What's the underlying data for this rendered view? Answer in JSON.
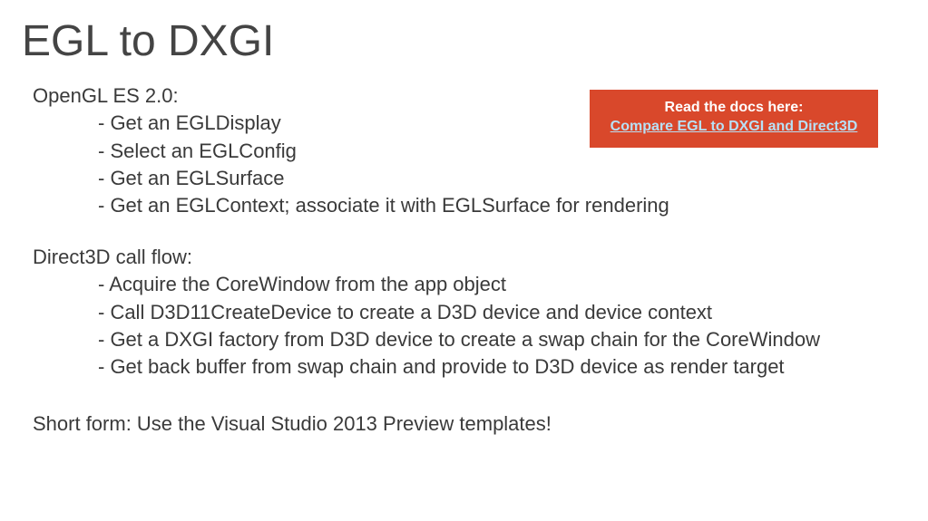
{
  "title": "EGL to DXGI",
  "section1": {
    "heading": "OpenGL ES 2.0:",
    "bullets": [
      "- Get an EGLDisplay",
      "- Select an EGLConfig",
      "- Get an EGLSurface",
      "- Get an EGLContext; associate it with EGLSurface for rendering"
    ]
  },
  "section2": {
    "heading": "Direct3D call flow:",
    "bullets": [
      "- Acquire the CoreWindow from the app object",
      "- Call D3D11CreateDevice to create a D3D device and device context",
      "- Get a DXGI factory from D3D device to create a swap chain for the CoreWindow",
      "- Get back buffer from swap chain and provide to D3D device as render target"
    ]
  },
  "shortform": "Short form: Use the Visual Studio 2013 Preview templates!",
  "callout": {
    "intro": "Read the docs here:",
    "link_text": "Compare EGL to DXGI and Direct3D"
  },
  "colors": {
    "callout_bg": "#d9482b",
    "link": "#b8e0f5"
  }
}
